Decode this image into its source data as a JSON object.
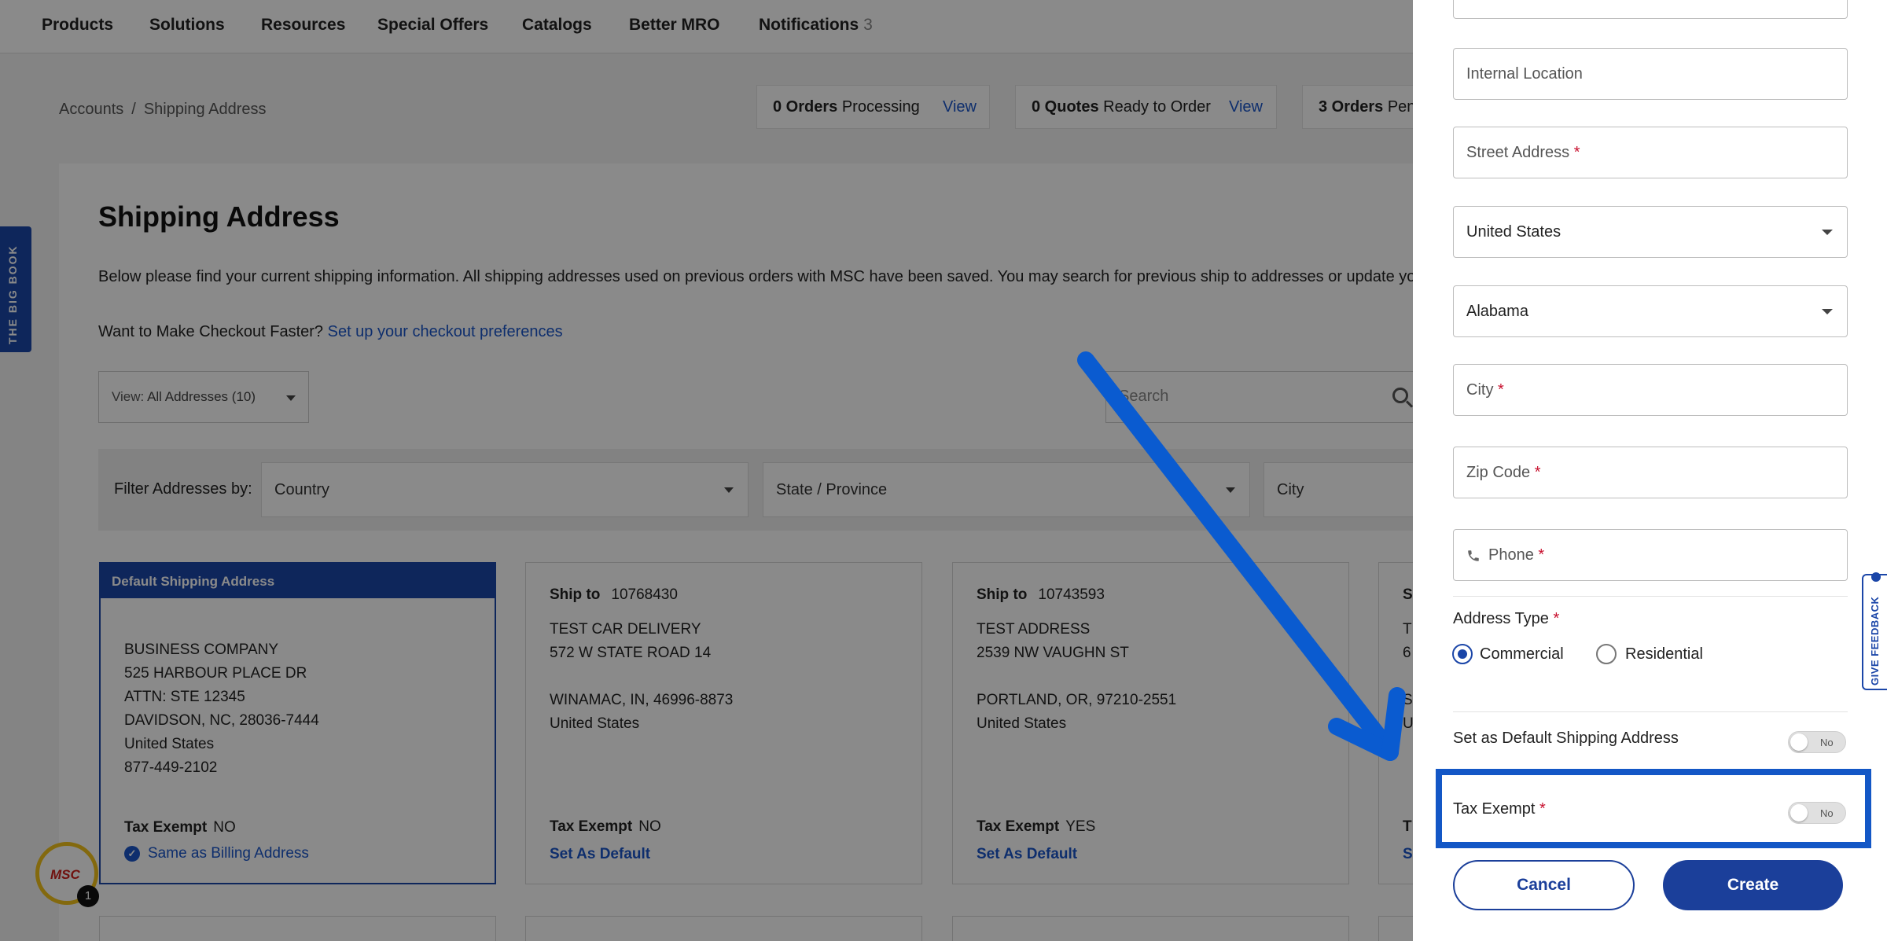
{
  "nav": {
    "items": [
      "Products",
      "Solutions",
      "Resources",
      "Special Offers",
      "Catalogs",
      "Better MRO",
      "Notifications"
    ],
    "notifications_count": "3"
  },
  "breadcrumb": {
    "root": "Accounts",
    "separator": "/",
    "current": "Shipping Address"
  },
  "orders_bar": [
    {
      "count": "0 Orders",
      "text": "Processing",
      "link": "View"
    },
    {
      "count": "0 Quotes",
      "text": "Ready to Order",
      "link": "View"
    },
    {
      "count": "3 Orders",
      "text": "Pen"
    }
  ],
  "side_tab": {
    "label": "THE BIG BOOK"
  },
  "page": {
    "title": "Shipping Address",
    "intro": "Below please find your current shipping information. All shipping addresses used on previous orders with MSC have been saved. You may search for previous ship to addresses or update yo",
    "checkout_prompt": "Want to Make Checkout Faster?",
    "checkout_link": "Set up your checkout preferences",
    "view_select": {
      "prefix": "View:",
      "value": "All Addresses (10)"
    },
    "search_placeholder": "Search"
  },
  "filters": {
    "label": "Filter Addresses by:",
    "country": "Country",
    "state": "State / Province",
    "city": "City"
  },
  "address_cards": [
    {
      "header": "Default Shipping Address",
      "lines": [
        "BUSINESS COMPANY",
        "525 HARBOUR PLACE DR",
        "ATTN: STE 12345",
        "DAVIDSON, NC, 28036-7444",
        "United States",
        "877-449-2102"
      ],
      "tax_label": "Tax Exempt",
      "tax_value": "NO",
      "link": "Same as Billing Address"
    },
    {
      "ship_to_label": "Ship to",
      "ship_to": "10768430",
      "lines": [
        "TEST CAR DELIVERY",
        "572 W STATE ROAD 14",
        "",
        "WINAMAC, IN, 46996-8873",
        "United States"
      ],
      "tax_label": "Tax Exempt",
      "tax_value": "NO",
      "link": "Set As Default"
    },
    {
      "ship_to_label": "Ship to",
      "ship_to": "10743593",
      "lines": [
        "TEST ADDRESS",
        "2539 NW VAUGHN ST",
        "",
        "PORTLAND, OR, 97210-2551",
        "United States"
      ],
      "tax_label": "Tax Exempt",
      "tax_value": "YES",
      "link": "Set As Default"
    },
    {
      "ship_to_label": "S",
      "lines": [
        "T",
        "6",
        "",
        "S",
        "U"
      ],
      "tax_label": "T",
      "link": "S"
    }
  ],
  "chat_badge": {
    "logo": "MSC",
    "count": "1"
  },
  "drawer": {
    "internal_location": "Internal Location",
    "street_address": "Street Address",
    "country": "United States",
    "state": "Alabama",
    "city": "City",
    "zip": "Zip Code",
    "phone": "Phone",
    "required_mark": "*",
    "address_type_label": "Address Type",
    "address_types": [
      "Commercial",
      "Residential"
    ],
    "selected_address_type": "Commercial",
    "default_label": "Set as Default Shipping Address",
    "default_toggle": "No",
    "tax_exempt_label": "Tax Exempt",
    "tax_exempt_toggle": "No",
    "cancel": "Cancel",
    "create": "Create"
  },
  "feedback_tab": {
    "label": "GIVE FEEDBACK"
  },
  "colors": {
    "brand_blue": "#1b46a8",
    "link_blue": "#1a56c9",
    "required_red": "#c8102e",
    "highlight_blue": "#1357c6",
    "arrow_blue": "#0a5bd0"
  },
  "icons": [
    "search-icon",
    "chevron-down-icon",
    "phone-icon",
    "check-circle-icon",
    "feedback-icon",
    "annotation-arrow"
  ]
}
